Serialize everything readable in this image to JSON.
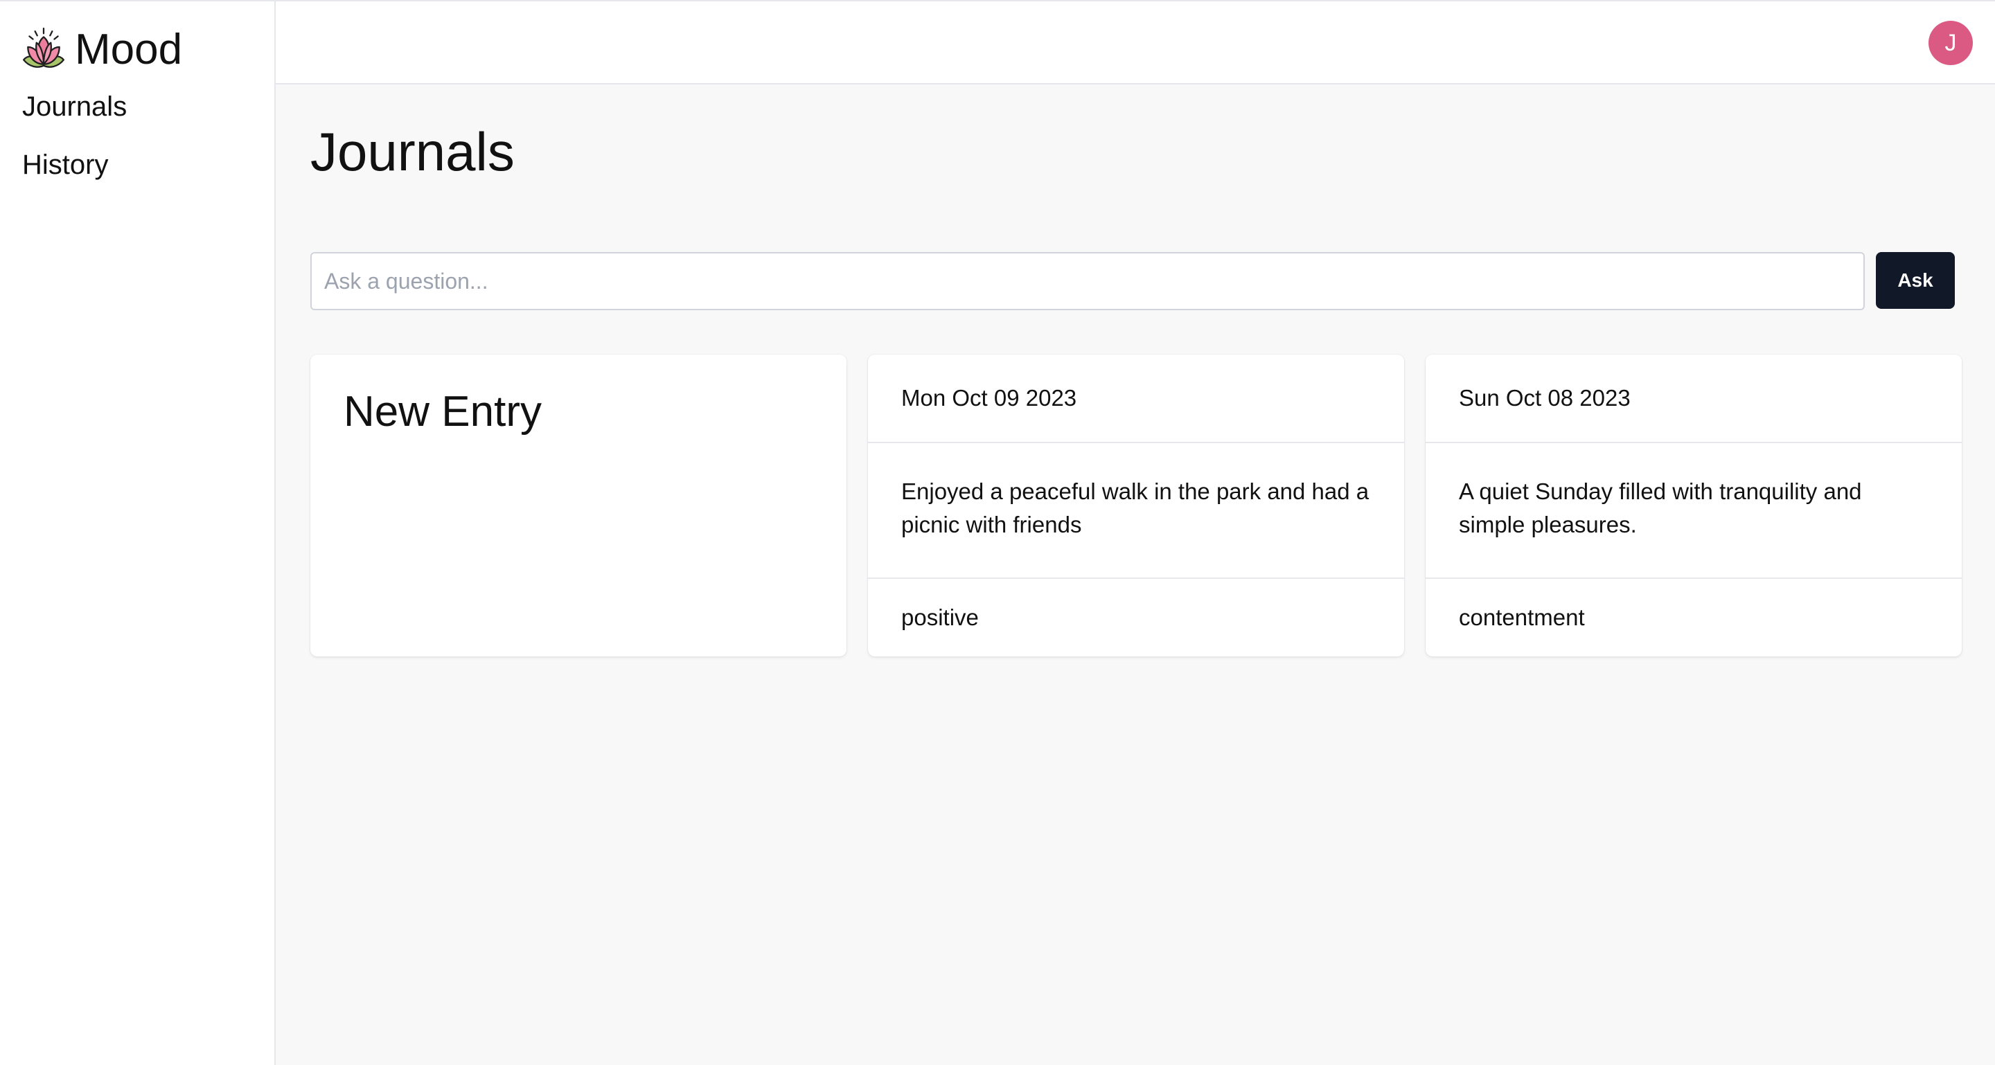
{
  "sidebar": {
    "brand": {
      "name": "Mood",
      "icon": "lotus-icon"
    },
    "items": [
      {
        "label": "Journals"
      },
      {
        "label": "History"
      }
    ]
  },
  "header": {
    "avatar_initial": "J",
    "avatar_color": "#db5a84"
  },
  "main": {
    "title": "Journals",
    "ask": {
      "placeholder": "Ask a question...",
      "value": "",
      "button_label": "Ask"
    },
    "new_entry_label": "New Entry",
    "entries": [
      {
        "date": "Mon Oct 09 2023",
        "summary": "Enjoyed a peaceful walk in the park and had a picnic with friends",
        "mood": "positive"
      },
      {
        "date": "Sun Oct 08 2023",
        "summary": "A quiet Sunday filled with tranquility and simple pleasures.",
        "mood": "contentment"
      }
    ]
  },
  "colors": {
    "accent_button": "#111827",
    "avatar": "#db5a84",
    "background_main": "#f8f8f8"
  }
}
